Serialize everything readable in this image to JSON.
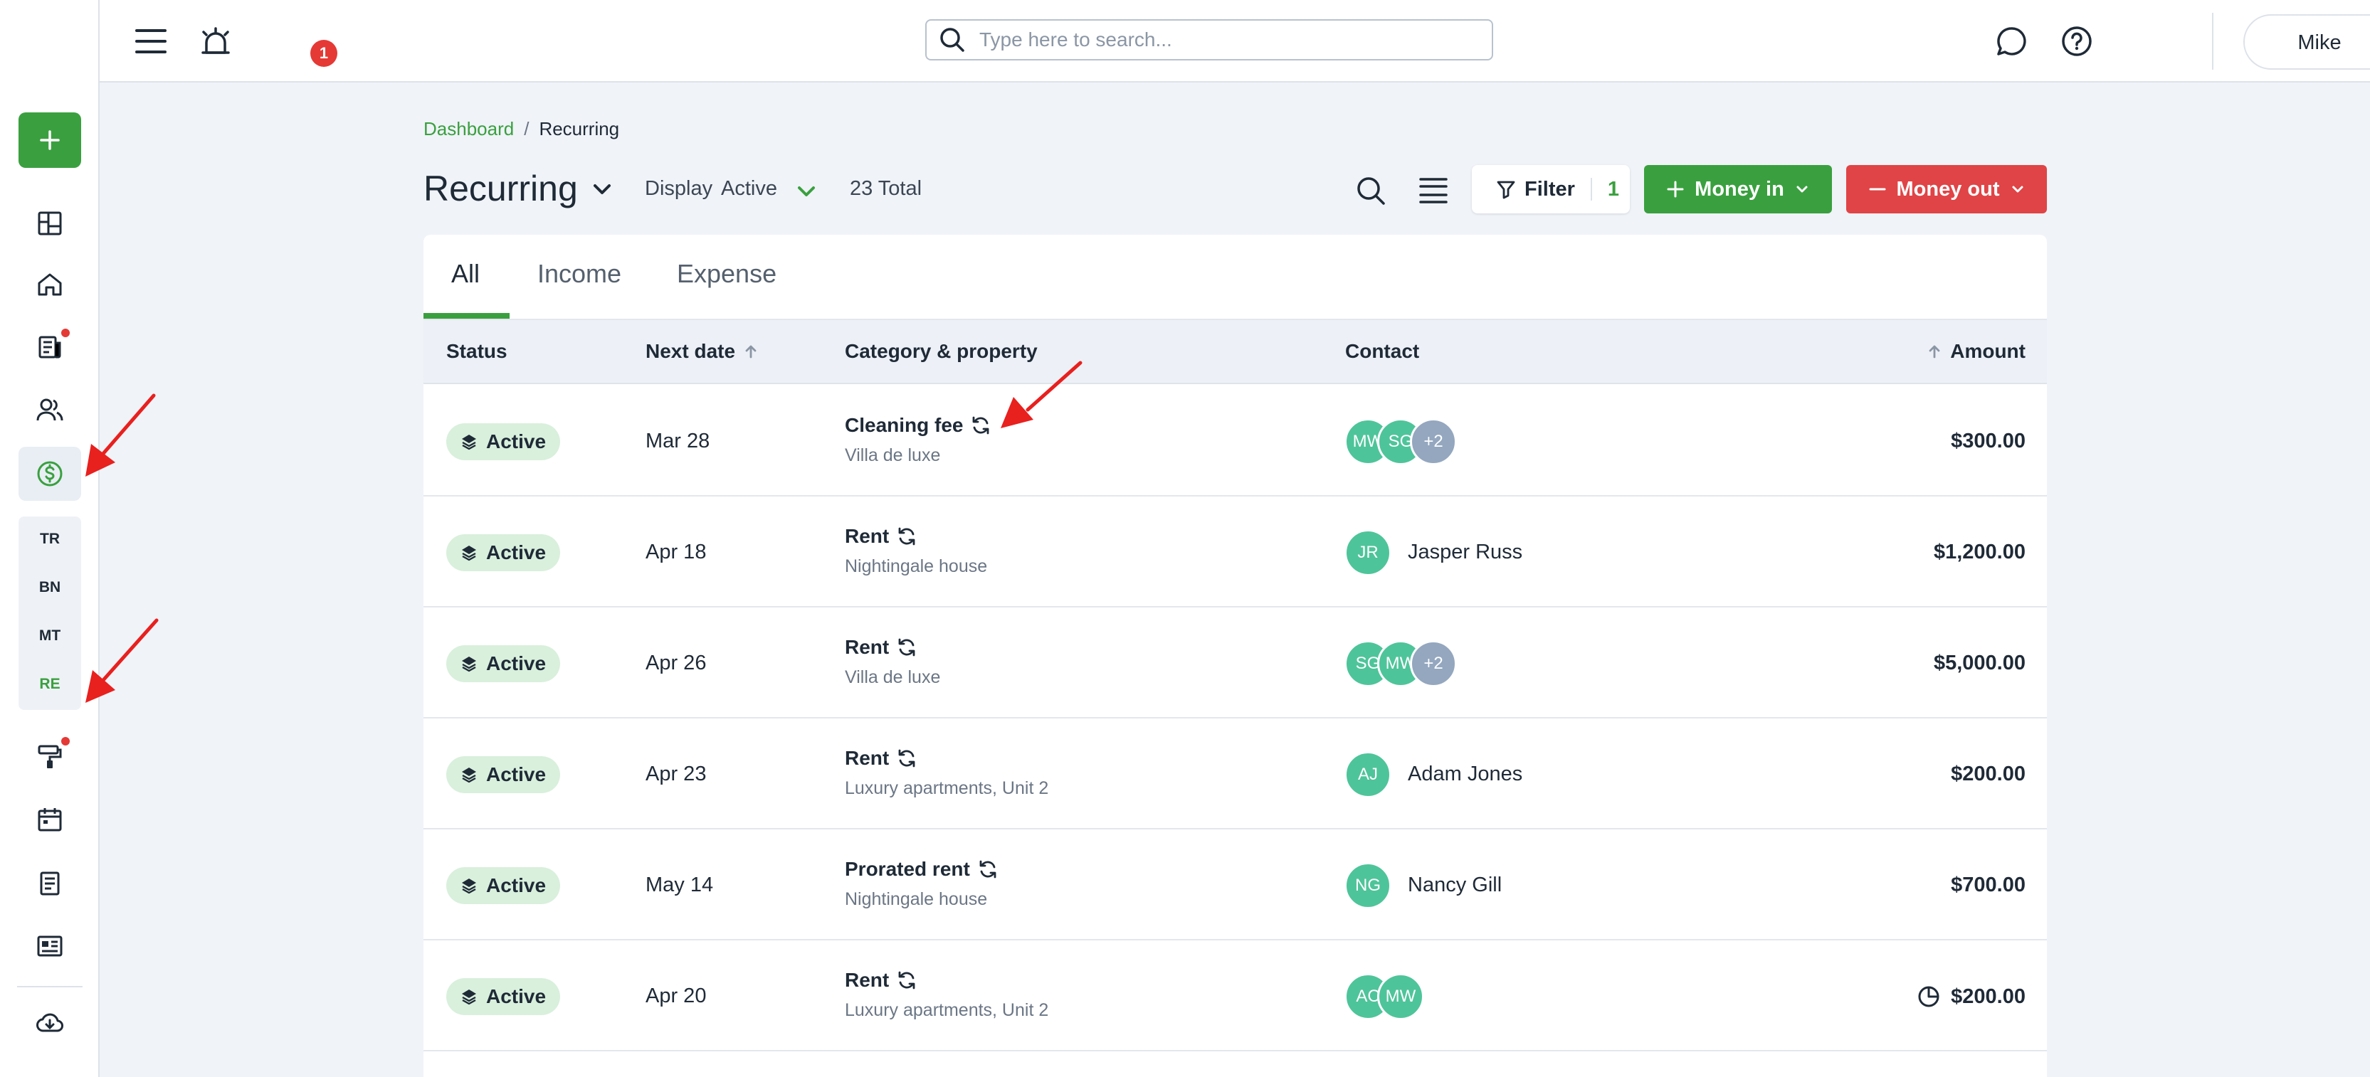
{
  "user": {
    "name": "Mike"
  },
  "notifications": {
    "count": "1"
  },
  "search": {
    "placeholder": "Type here to search..."
  },
  "sidebar": {
    "sub_items": [
      {
        "label": "TR",
        "active": false
      },
      {
        "label": "BN",
        "active": false
      },
      {
        "label": "MT",
        "active": false
      },
      {
        "label": "RE",
        "active": true
      }
    ]
  },
  "breadcrumb": {
    "parent": "Dashboard",
    "separator": "/",
    "current": "Recurring"
  },
  "page": {
    "title": "Recurring",
    "display_label": "Display",
    "display_value": "Active",
    "total": "23 Total"
  },
  "toolbar": {
    "filter_label": "Filter",
    "filter_count": "1",
    "money_in": "Money in",
    "money_out": "Money out"
  },
  "tabs": [
    {
      "label": "All",
      "active": true
    },
    {
      "label": "Income",
      "active": false
    },
    {
      "label": "Expense",
      "active": false
    }
  ],
  "columns": {
    "status": "Status",
    "next_date": "Next date",
    "category": "Category & property",
    "contact": "Contact",
    "amount": "Amount"
  },
  "rows": [
    {
      "status": "Active",
      "next_date": "Mar 28",
      "category": "Cleaning fee",
      "property": "Villa de luxe",
      "avatars": [
        "MW",
        "SG",
        "+2"
      ],
      "contact": "",
      "amount": "$300.00",
      "partial": false
    },
    {
      "status": "Active",
      "next_date": "Apr 18",
      "category": "Rent",
      "property": "Nightingale house",
      "avatars": [
        "JR"
      ],
      "contact": "Jasper Russ",
      "amount": "$1,200.00",
      "partial": false
    },
    {
      "status": "Active",
      "next_date": "Apr 26",
      "category": "Rent",
      "property": "Villa de luxe",
      "avatars": [
        "SG",
        "MW",
        "+2"
      ],
      "contact": "",
      "amount": "$5,000.00",
      "partial": false
    },
    {
      "status": "Active",
      "next_date": "Apr 23",
      "category": "Rent",
      "property": "Luxury apartments, Unit 2",
      "avatars": [
        "AJ"
      ],
      "contact": "Adam Jones",
      "amount": "$200.00",
      "partial": false
    },
    {
      "status": "Active",
      "next_date": "May 14",
      "category": "Prorated rent",
      "property": "Nightingale house",
      "avatars": [
        "NG"
      ],
      "contact": "Nancy Gill",
      "amount": "$700.00",
      "partial": false
    },
    {
      "status": "Active",
      "next_date": "Apr 20",
      "category": "Rent",
      "property": "Luxury apartments, Unit 2",
      "avatars": [
        "AC",
        "MW"
      ],
      "contact": "",
      "amount": "$200.00",
      "partial": true
    }
  ],
  "colors": {
    "accent": "#3aa03f",
    "danger": "#e04446",
    "annotation": "#e8201e"
  }
}
